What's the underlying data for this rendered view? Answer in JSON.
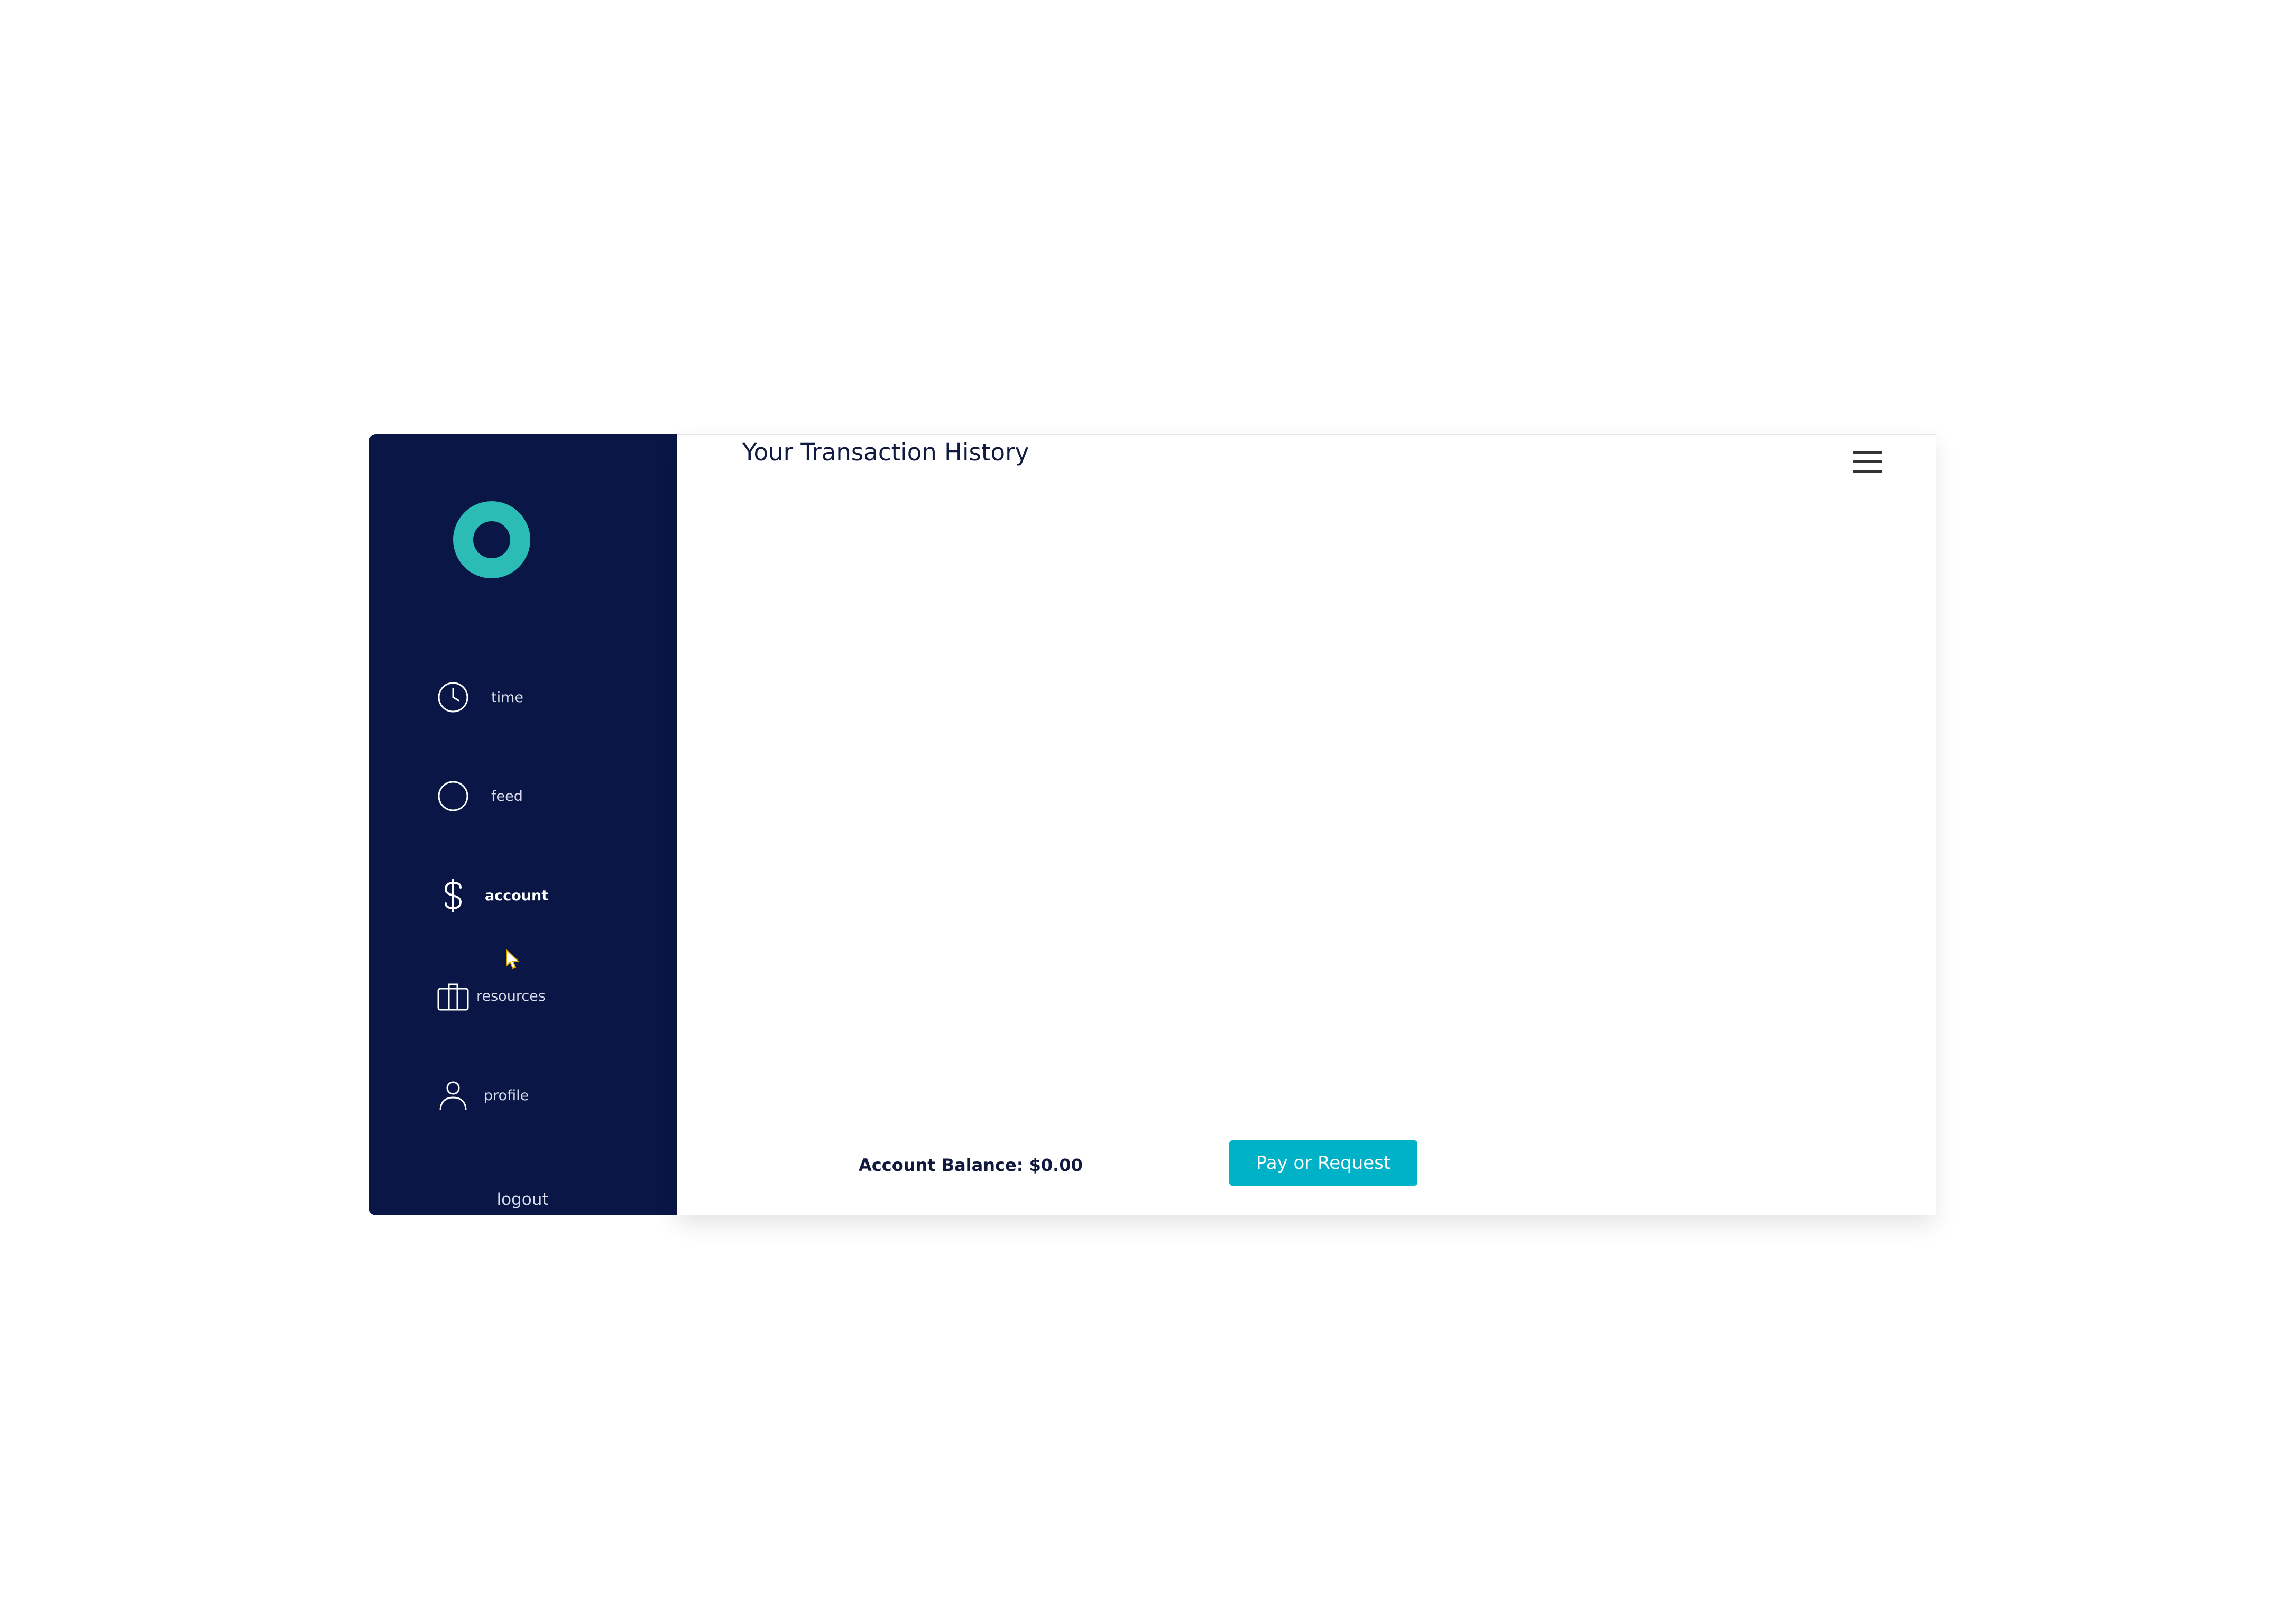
{
  "header": {
    "title": "Your Transaction History"
  },
  "sidebar": {
    "items": [
      {
        "label": "time",
        "icon": "clock-icon"
      },
      {
        "label": "feed",
        "icon": "circle-icon"
      },
      {
        "label": "account",
        "icon": "dollar-icon",
        "active": true
      },
      {
        "label": "resources",
        "icon": "briefcase-icon"
      },
      {
        "label": "profile",
        "icon": "user-icon"
      }
    ],
    "logout_label": "logout"
  },
  "footer": {
    "balance_text": "Account Balance: $0.00",
    "pay_button_label": "Pay or Request"
  },
  "colors": {
    "sidebar_bg": "#091646",
    "logo_accent": "#2bbdb5",
    "button_bg": "#00b2c8",
    "title_text": "#0f1a3e"
  }
}
